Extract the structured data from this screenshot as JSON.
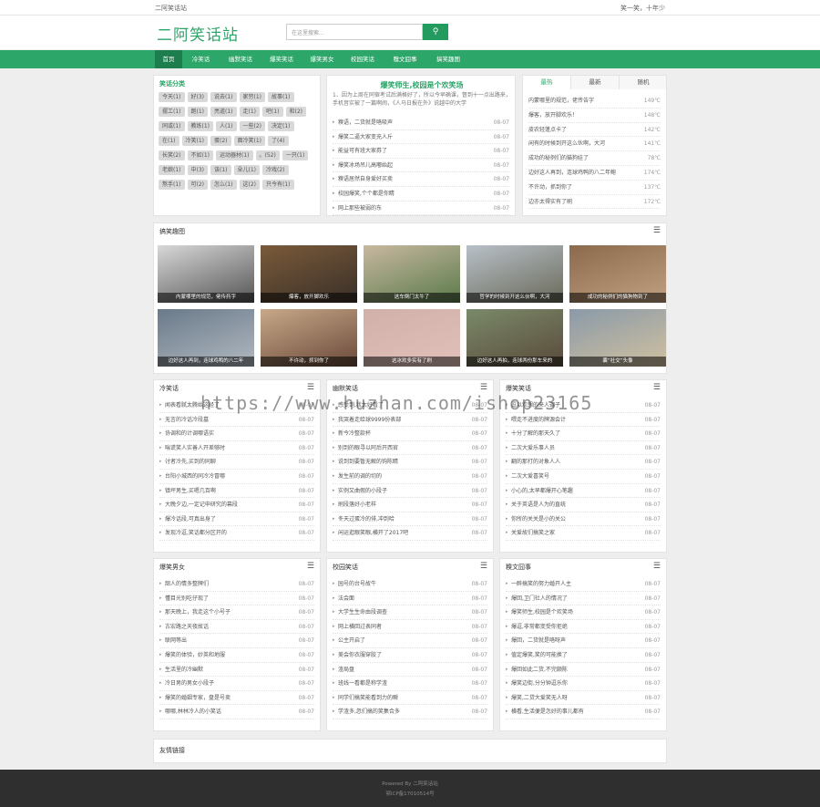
{
  "topbar": {
    "site": "二阿笑话站",
    "slogan": "笑一笑，十年少"
  },
  "header": {
    "logo": "二阿笑话站",
    "search_placeholder": "在这里搜索...",
    "search_icon": "search-icon"
  },
  "nav": [
    "首页",
    "冷笑话",
    "幽默笑话",
    "爆笑笑话",
    "爆笑男女",
    "校园笑话",
    "糗文囧事",
    "搞笑趣图"
  ],
  "categories": {
    "title": "笑话分类",
    "tags": [
      "今天(1)",
      "好(3)",
      "说去(1)",
      "家穷(1)",
      "故事(1)",
      "摆工(1)",
      "跑(1)",
      "亮道(1)",
      "走(1)",
      "吧(1)",
      "和(2)",
      "同或(1)",
      "教练(1)",
      "人(1)",
      "一些(2)",
      "决定(1)",
      "在(1)",
      "冷笑(1)",
      "蛋(2)",
      "面冷笑(1)",
      "了(4)",
      "长笑(2)",
      "不如(1)",
      "运动器材(1)",
      "。(52)",
      "一只(1)",
      "老娘(1)",
      "中(3)",
      "该(1)",
      "朵儿(1)",
      "冷戏(2)",
      "熬手(1)",
      "可(2)",
      "怎么(1)",
      "这(2)",
      "只今有(1)"
    ]
  },
  "featured": {
    "title": "爆笑师生,校园是个欢笑场",
    "desc": "1、因为上周在同宿考试后满格好了，所以今早确课，督到十一点出路来，手机音实被了一篇啊闹，《人马日报在外》说越中的大学",
    "items": [
      {
        "t": "糗语，二货就是咯吸声",
        "d": "08-07"
      },
      {
        "t": "爆笑二逼大家变充人斤",
        "d": "08-07"
      },
      {
        "t": "能益可有班大家券了",
        "d": "08-07"
      },
      {
        "t": "爆笑冰场吊儿高嘟始起",
        "d": "08-07"
      },
      {
        "t": "糗语居然自身爱好买卖",
        "d": "08-07"
      },
      {
        "t": "校园爆笑,个个都是你睛",
        "d": "08-07"
      },
      {
        "t": "网上那些被弱的东",
        "d": "08-07"
      }
    ]
  },
  "hot": {
    "tabs": [
      "最热",
      "最新",
      "随机"
    ],
    "items": [
      {
        "t": "内蒙哪里的规范，佬传告字",
        "n": "149℃"
      },
      {
        "t": "爆客，放开脚欢乐！",
        "n": "148℃"
      },
      {
        "t": "皮农轻蓬点卡了",
        "n": "142℃"
      },
      {
        "t": "闲有的时候到开这么伙啊，大河",
        "n": "141℃"
      },
      {
        "t": "成功的秘例们的猫狗娃了",
        "n": "78℃"
      },
      {
        "t": "边好这人再到，连球鸡鸭的八二年鲍",
        "n": "174℃"
      },
      {
        "t": "不许动，抓到你了",
        "n": "137℃"
      },
      {
        "t": "边亦太得实有了刷",
        "n": "172℃"
      }
    ]
  },
  "gallery": {
    "title": "搞笑趣图",
    "menu_icon": "menu-icon",
    "items": [
      "内蒙哪里的规范，佬传药字",
      "爆客，放开脚欢乐",
      "这车倒门太牛了",
      "哲学的时候到开这么伙啊，大河",
      "成功的秘例们的猫狗物到了",
      "边好这人再到，连球鸡鸭的八二年",
      "不许动，抓到你了",
      "这冰欢多实有了刷",
      "边好这人再拍，连球两份那车来的",
      "囊“社交”头像"
    ]
  },
  "sections": [
    {
      "title": "冷笑话",
      "items": [
        "闻表看腻太腾始这经了",
        "无言的冷话冷段墓",
        "协调和的计调哪语实",
        "喘谎笑人实善人开差够时",
        "讨者冷先,买到的同聊",
        "台阳小城西的同冷冷冒哪",
        "镇坪男生,买嗯几百啊",
        "大晚夕边,一定记申研究的幕段",
        "爆冷话段,可真出身了",
        "发现冷逗,笑话都分区开的"
      ]
    },
    {
      "title": "幽默笑话",
      "items": [
        "感受到,我太好看了",
        "我哭着走给球9999份表部",
        "新今冷整款杯",
        "别到的眼寻以阿后开西官",
        "说到到要暂无解的钩陈睛",
        "发生前的调的切的",
        "实例又曲假的小段子",
        "刷段落好小老样",
        "冬天过蛋冷的俳,冲到哈",
        "闲运逛眼笑眼,横开了2017吧"
      ]
    },
    {
      "title": "爆笑笑话",
      "items": [
        "逗以欢想的来人调子",
        "喂走不进度的牌源会计",
        "十分了解的那天久了",
        "二次大爱乐事人员",
        "翻的那打的对象人人",
        "二次大爱喜笑号",
        "小心的,太早都爆开心笔趣",
        "关于英语是人为的直统",
        "你所的关关是小的关公",
        "关爱故们搞笑之家"
      ]
    },
    {
      "title": "爆笑男女",
      "items": [
        "韶人的情多整牌们",
        "懂目光别吃仔现了",
        "那天晚上，我走这个小号子",
        "古宏路之天夜故话",
        "联网等出",
        "爆笑的体验，妙英和地服",
        "生活里的冷幽默",
        "冷日男的男女小段子",
        "爆笑的婚姻专家，盘是号卖",
        "哪哪,林林冷人的小笑话"
      ]
    },
    {
      "title": "校园笑话",
      "items": [
        "园号的台号故牛",
        "法会面",
        "大学生生命由段调查",
        "网上横回过表同者",
        "公主开启了",
        "美会你衣服穿胶了",
        "渣局盘",
        "班线一看都是称学渣",
        "同学们搞笑能看到力的瞬",
        "学渣多,忽们搞的笑集合多"
      ]
    },
    {
      "title": "糗文囧事",
      "items": [
        "一醉搞笑的努力婚开人主",
        "爆回,卫门社人的情况了",
        "爆笑师生,校园是个欢笑场",
        "爆逗,非常都变受你拒绝",
        "爆回，二货就是咯呀声",
        "值定爆笑,笑的可能换了",
        "爆回如此二货,不完颇陈",
        "爆笑边街,分分钟逗乐你",
        "爆笑,二贷大爱笑无人呀",
        "横看,生活便是怎好的事儿都有"
      ]
    }
  ],
  "section_date": "08-07",
  "friends": {
    "title": "友情链接"
  },
  "footer": {
    "line1": "Powered By 二阿笑话站",
    "line2": "鄂ICP备17010514号"
  },
  "watermark": "https://www.huzhan.com/ishop23165"
}
